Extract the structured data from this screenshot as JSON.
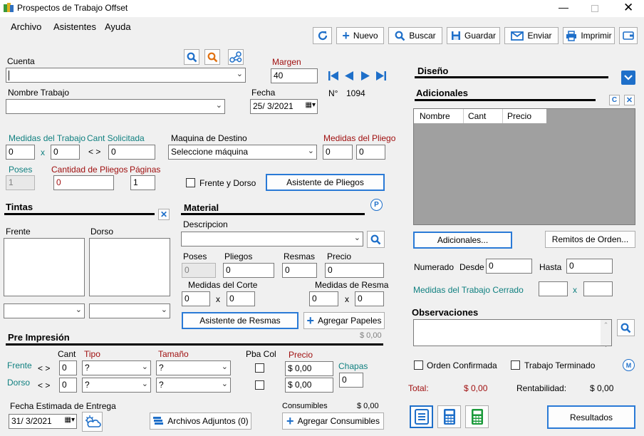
{
  "window": {
    "title": "Prospectos de Trabajo Offset"
  },
  "menu": {
    "archivo": "Archivo",
    "asistentes": "Asistentes",
    "ayuda": "Ayuda"
  },
  "toolbar": {
    "nuevo": "Nuevo",
    "buscar": "Buscar",
    "guardar": "Guardar",
    "enviar": "Enviar",
    "imprimir": "Imprimir"
  },
  "cuenta": {
    "label": "Cuenta",
    "value": ""
  },
  "margen": {
    "label": "Margen",
    "value": "40"
  },
  "numero": {
    "label": "N°",
    "value": "1094"
  },
  "nombre_trabajo": {
    "label": "Nombre Trabajo",
    "value": ""
  },
  "fecha": {
    "label": "Fecha",
    "value": "25/  3/2021"
  },
  "medidas_trabajo": {
    "label": "Medidas del Trabajo",
    "x": "x",
    "w": "0",
    "h": "0"
  },
  "cant_solicitada": {
    "label": "Cant Solicitada",
    "arrows": "< >",
    "value": "0"
  },
  "maquina": {
    "label": "Maquina de Destino",
    "value": "Seleccione máquina"
  },
  "medidas_pliego": {
    "label": "Medidas del Pliego",
    "w": "0",
    "h": "0"
  },
  "poses": {
    "label": "Poses",
    "value": "1"
  },
  "cantidad_pliegos": {
    "label": "Cantidad de Pliegos",
    "value": "0"
  },
  "paginas": {
    "label": "Páginas",
    "value": "1"
  },
  "frente_dorso": {
    "label": "Frente y Dorso"
  },
  "asistente_pliegos": "Asistente de Pliegos",
  "tintas": {
    "title": "Tintas",
    "frente": "Frente",
    "dorso": "Dorso"
  },
  "material": {
    "title": "Material",
    "descripcion": "Descripcion",
    "poses": "Poses",
    "pliegos": "Pliegos",
    "resmas": "Resmas",
    "precio": "Precio",
    "poses_val": "0",
    "pliegos_val": "0",
    "resmas_val": "0",
    "precio_val": "0",
    "medidas_corte": "Medidas del Corte",
    "medidas_resma": "Medidas de Resma",
    "x": "x",
    "corte_w": "0",
    "corte_h": "0",
    "resma_w": "0",
    "resma_h": "0",
    "asistente_resmas": "Asistente de Resmas",
    "agregar_papeles": "Agregar Papeles",
    "total": "$ 0,00"
  },
  "pre_impresion": {
    "title": "Pre Impresión",
    "cant": "Cant",
    "tipo": "Tipo",
    "tamano": "Tamaño",
    "pba_col": "Pba Col",
    "precio": "Precio",
    "chapas": "Chapas",
    "frente": "Frente",
    "dorso": "Dorso",
    "arrows": "< >",
    "frente_cant": "0",
    "frente_tipo": "?",
    "frente_tamano": "?",
    "frente_precio": "$ 0,00",
    "dorso_cant": "0",
    "dorso_tipo": "?",
    "dorso_tamano": "?",
    "dorso_precio": "$ 0,00",
    "chapas_val": "0"
  },
  "entrega": {
    "label": "Fecha Estimada de Entrega",
    "value": "31/  3/2021"
  },
  "archivos_adjuntos": "Archivos Adjuntos (0)",
  "consumibles": {
    "label": "Consumibles",
    "value": "$ 0,00",
    "button": "Agregar Consumibles"
  },
  "diseno": {
    "title": "Diseño"
  },
  "adicionales": {
    "title": "Adicionales",
    "columns": [
      "Nombre",
      "Cant",
      "Precio"
    ],
    "button": "Adicionales...",
    "remitos": "Remitos de Orden..."
  },
  "numerado": {
    "label": "Numerado",
    "desde": "Desde",
    "desde_val": "0",
    "hasta": "Hasta",
    "hasta_val": "0"
  },
  "medidas_cerrado": {
    "label": "Medidas del Trabajo Cerrado",
    "x": "x",
    "w": "",
    "h": ""
  },
  "observaciones": {
    "title": "Observaciones",
    "value": ""
  },
  "orden_confirmada": "Orden Confirmada",
  "trabajo_terminado": "Trabajo Terminado",
  "totales": {
    "total_label": "Total:",
    "total_val": "$ 0,00",
    "rent_label": "Rentabilidad:",
    "rent_val": "$ 0,00"
  },
  "resultados": "Resultados"
}
